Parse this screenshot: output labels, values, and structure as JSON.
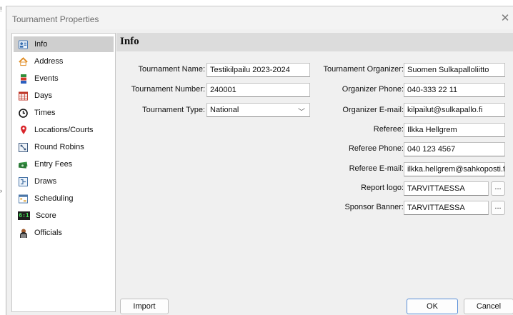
{
  "window": {
    "title": "Tournament Properties",
    "close_glyph": "✕"
  },
  "edge_glyphs": {
    "top": "!",
    "mid": "›"
  },
  "sidebar": {
    "items": [
      {
        "label": "Info",
        "icon": "info-card-icon",
        "active": true
      },
      {
        "label": "Address",
        "icon": "house-icon"
      },
      {
        "label": "Events",
        "icon": "book-stack-icon"
      },
      {
        "label": "Days",
        "icon": "calendar-icon"
      },
      {
        "label": "Times",
        "icon": "clock-icon"
      },
      {
        "label": "Locations/Courts",
        "icon": "location-pin-icon"
      },
      {
        "label": "Round Robins",
        "icon": "round-robin-icon"
      },
      {
        "label": "Entry Fees",
        "icon": "money-icon"
      },
      {
        "label": "Draws",
        "icon": "draw-icon"
      },
      {
        "label": "Scheduling",
        "icon": "scheduling-icon"
      },
      {
        "label": "Score",
        "icon": "scoreboard-icon",
        "score_glyph": "6:1"
      },
      {
        "label": "Officials",
        "icon": "official-icon"
      }
    ]
  },
  "panel": {
    "header": "Info"
  },
  "form": {
    "tournament_name": {
      "label": "Tournament Name:",
      "value": "Testikilpailu 2023-2024"
    },
    "tournament_number": {
      "label": "Tournament Number:",
      "value": "240001"
    },
    "tournament_type": {
      "label": "Tournament Type:",
      "value": "National",
      "chevron": "﹀"
    },
    "organizer": {
      "label": "Tournament Organizer:",
      "value": "Suomen Sulkapalloliitto"
    },
    "organizer_phone": {
      "label": "Organizer Phone:",
      "value": "040-333 22 11"
    },
    "organizer_email": {
      "label": "Organizer E-mail:",
      "value": "kilpailut@sulkapallo.fi"
    },
    "referee": {
      "label": "Referee:",
      "value": "Ilkka Hellgrem"
    },
    "referee_phone": {
      "label": "Referee Phone:",
      "value": "040 123 4567"
    },
    "referee_email": {
      "label": "Referee E-mail:",
      "value": "ilkka.hellgrem@sahkoposti.fi"
    },
    "report_logo": {
      "label": "Report logo:",
      "value": "TARVITTAESSA",
      "browse": "..."
    },
    "sponsor_banner": {
      "label": "Sponsor Banner:",
      "value": "TARVITTAESSA",
      "browse": "..."
    }
  },
  "footer": {
    "import_label": "Import",
    "ok_label": "OK",
    "cancel_label": "Cancel"
  },
  "colors": {
    "accent_border": "#5a8fd8",
    "active_nav": "#cfcfcf",
    "header_band": "#dcdcdc"
  }
}
